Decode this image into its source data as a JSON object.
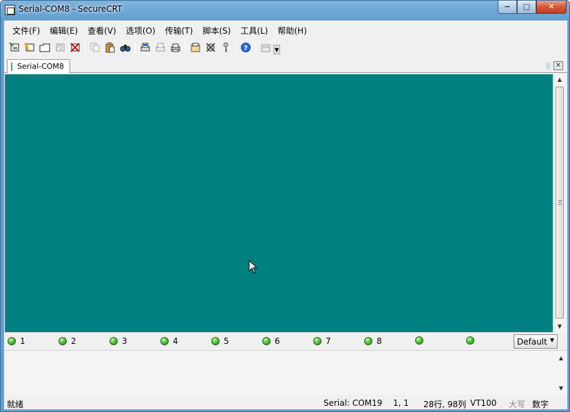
{
  "window": {
    "title": "Serial-COM8 - SecureCRT",
    "controls": {
      "minimize": "−",
      "maximize": "□",
      "close": "✕"
    }
  },
  "menu": [
    {
      "label": "文件(F)"
    },
    {
      "label": "编辑(E)"
    },
    {
      "label": "查看(V)"
    },
    {
      "label": "选项(O)"
    },
    {
      "label": "传输(T)"
    },
    {
      "label": "脚本(S)"
    },
    {
      "label": "工具(L)"
    },
    {
      "label": "帮助(H)"
    }
  ],
  "toolbar": {
    "icons": [
      "connect-icon",
      "quick-connect-icon",
      "connect-in-tab-icon",
      "reconnect-icon",
      "disconnect-icon",
      "copy-icon",
      "paste-icon",
      "find-icon",
      "print-screen-icon",
      "print-selection-icon",
      "print-icon",
      "session-options-icon",
      "global-options-icon",
      "key-icon",
      "help-icon",
      "keymap-icon"
    ]
  },
  "tabs": [
    {
      "label": "Serial-COM8",
      "status": "connected"
    }
  ],
  "terminal": {
    "background_color": "#008080"
  },
  "button_bar": {
    "buttons": [
      {
        "label": "1"
      },
      {
        "label": "2"
      },
      {
        "label": "3"
      },
      {
        "label": "4"
      },
      {
        "label": "5"
      },
      {
        "label": "6"
      },
      {
        "label": "7"
      },
      {
        "label": "8"
      },
      {
        "label": ""
      },
      {
        "label": ""
      }
    ],
    "selected_bar": "Default"
  },
  "status_bar": {
    "ready": "就绪",
    "connection": "Serial: COM19",
    "cursor_pos": "1,   1",
    "size": "28行, 98列",
    "emulation": "VT100",
    "caps": "大写",
    "num": "数字"
  }
}
